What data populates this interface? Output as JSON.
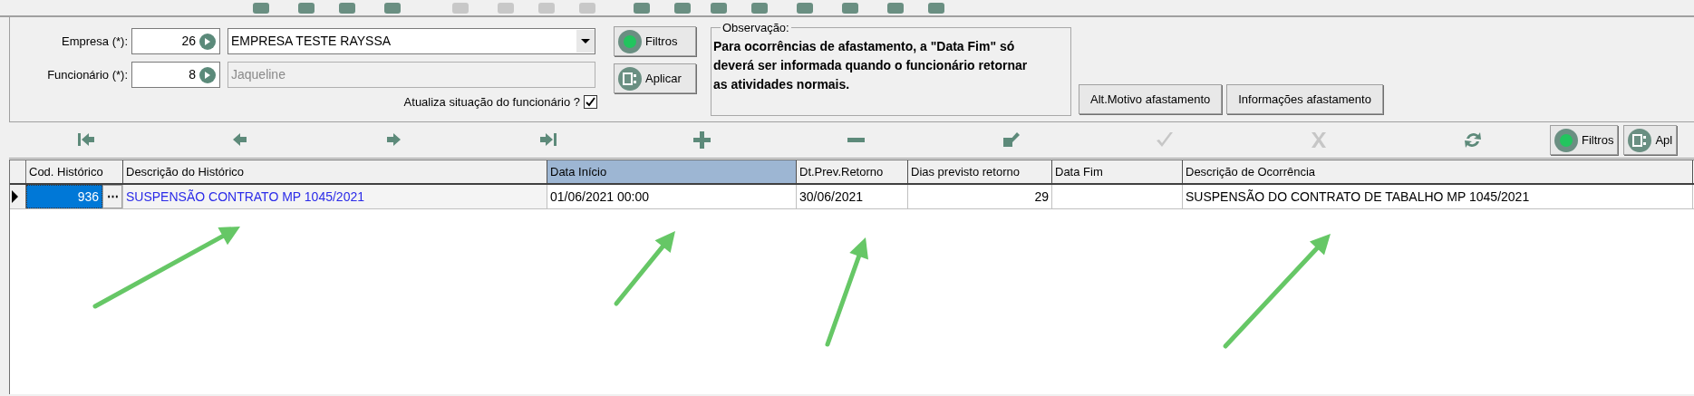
{
  "form": {
    "fields": [
      {
        "label": "Empresa (*):",
        "code": "26",
        "name": "EMPRESA TESTE RAYSSA",
        "kind": "combo"
      },
      {
        "label": "Funcionário (*):",
        "code": "8",
        "name": "Jaqueline",
        "kind": "readonly"
      }
    ],
    "update_check": {
      "label": "Atualiza situação do funcionário ?",
      "checked": true
    },
    "buttons": [
      {
        "kind": "filter",
        "label": "Filtros"
      },
      {
        "kind": "apply",
        "label": "Aplicar"
      }
    ]
  },
  "observation": {
    "title": "Observação:",
    "text": "Para ocorrências de afastamento, a \"Data Fim\" só deverá ser informada quando o funcionário retornar as atividades normais."
  },
  "actions": [
    "Alt.Motivo afastamento",
    "Informações afastamento"
  ],
  "nav_buttons": [
    {
      "kind": "first",
      "disabled": false
    },
    {
      "kind": "prev",
      "disabled": false
    },
    {
      "kind": "next",
      "disabled": false
    },
    {
      "kind": "last",
      "disabled": false
    },
    {
      "kind": "add",
      "disabled": false
    },
    {
      "kind": "remove",
      "disabled": false
    },
    {
      "kind": "edit",
      "disabled": false
    },
    {
      "kind": "confirm",
      "disabled": true
    },
    {
      "kind": "cancel",
      "disabled": true
    },
    {
      "kind": "refresh",
      "disabled": false
    }
  ],
  "grid_buttons": [
    {
      "kind": "filter",
      "label": "Filtros"
    },
    {
      "kind": "apply",
      "label": "Apl"
    }
  ],
  "table": {
    "columns": [
      {
        "label": "Cod. Histórico",
        "selected": false
      },
      {
        "label": "Descrição do Histórico",
        "selected": false
      },
      {
        "label": "Data Início",
        "selected": true
      },
      {
        "label": "Dt.Prev.Retorno",
        "selected": false
      },
      {
        "label": "Dias previsto retorno",
        "selected": false
      },
      {
        "label": "Data Fim",
        "selected": false
      },
      {
        "label": "Descrição de Ocorrência",
        "selected": false
      }
    ],
    "rows": [
      {
        "current": true,
        "lookup": "⋯",
        "cells": [
          "936",
          "SUSPENSÃO CONTRATO MP 1045/2021",
          "01/06/2021 00:00",
          "30/06/2021",
          "29",
          "",
          "SUSPENSÃO DO CONTRATO DE TABALHO MP 1045/2021"
        ]
      }
    ]
  }
}
